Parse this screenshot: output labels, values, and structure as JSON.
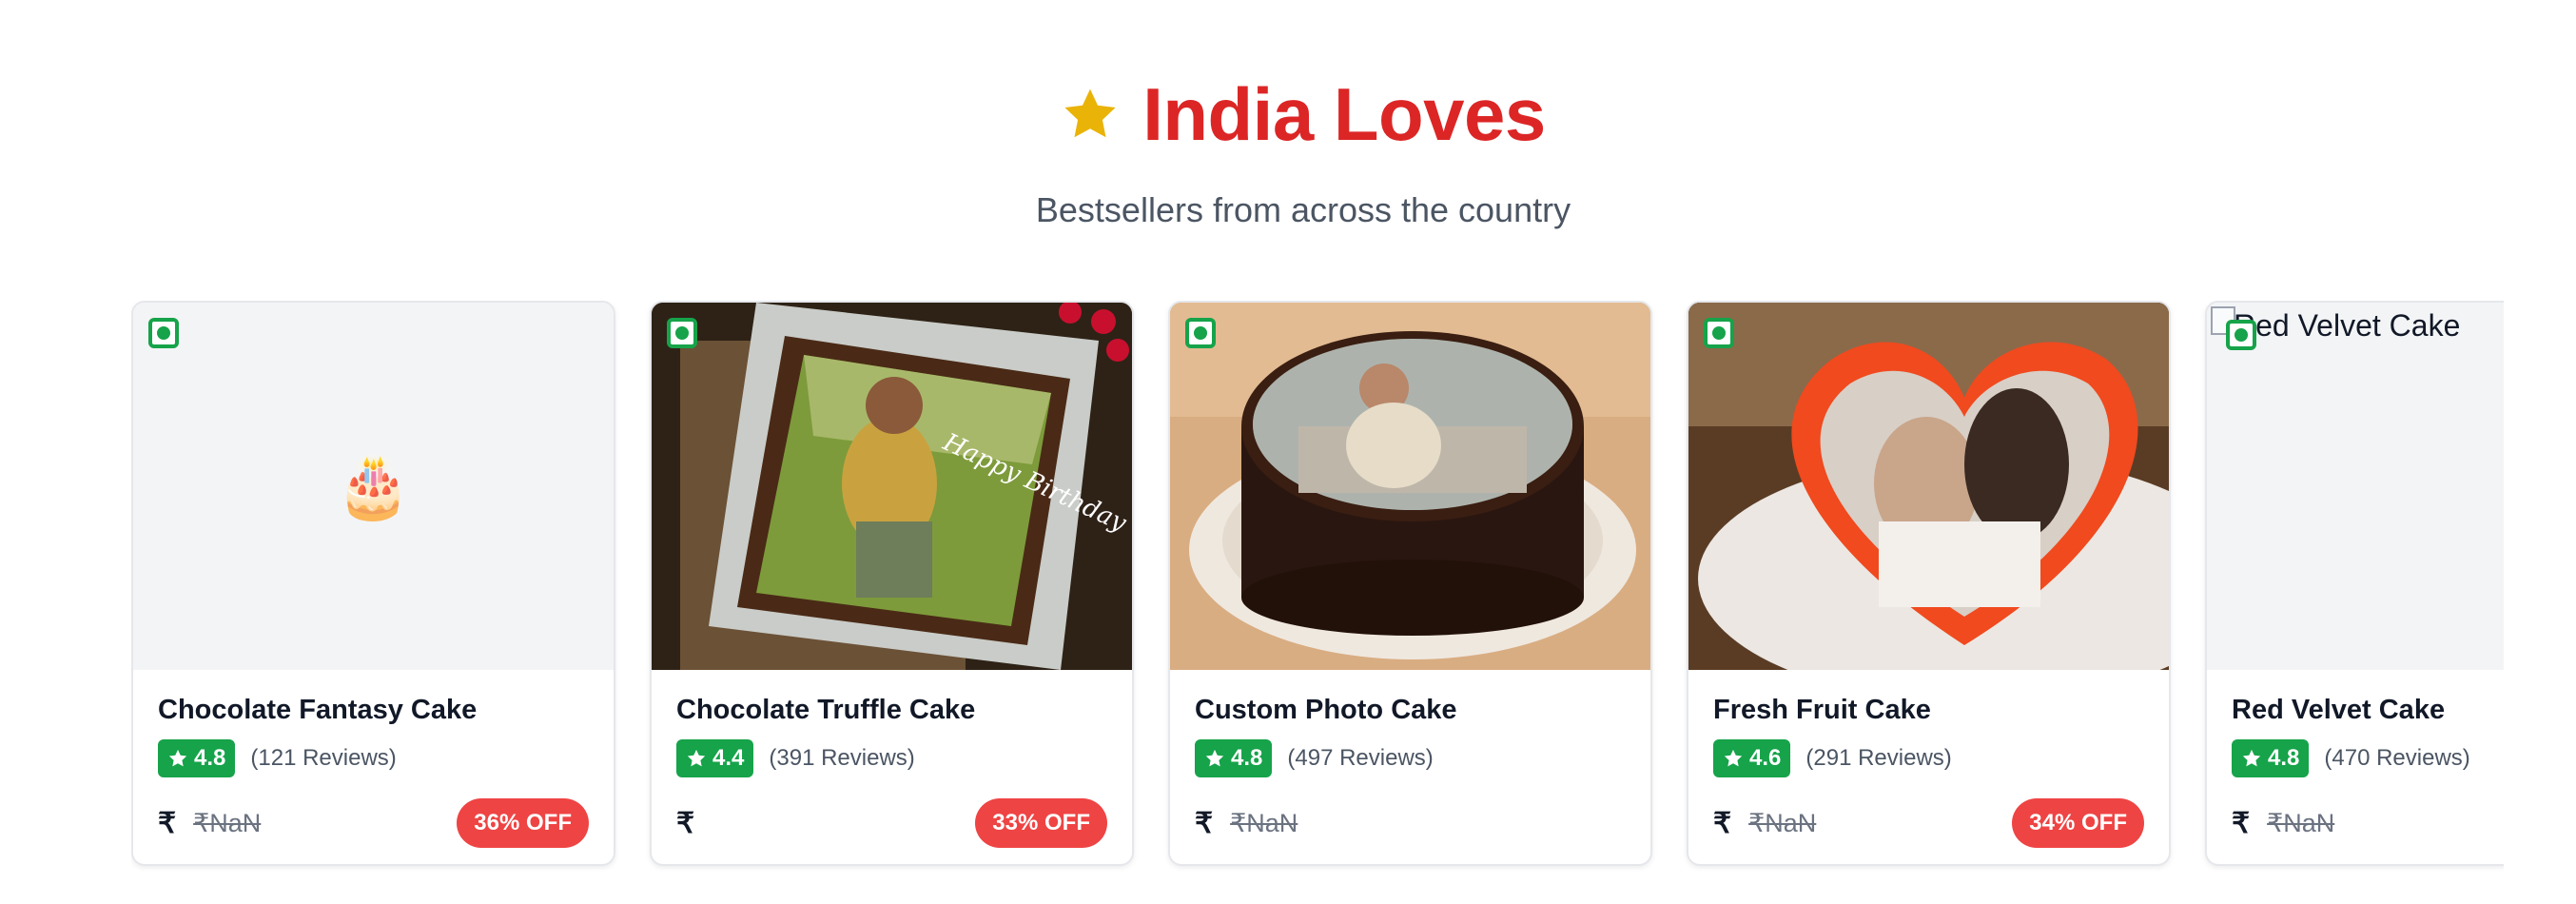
{
  "section": {
    "title": "India Loves",
    "subtitle": "Bestsellers from across the country",
    "star_color": "#eab308",
    "title_color": "#dc2626"
  },
  "products": [
    {
      "name": "Chocolate Fantasy Cake",
      "rating": "4.8",
      "reviews": "(121 Reviews)",
      "currency": "₹",
      "old_price": "₹NaN",
      "discount": "36% OFF",
      "image": "cake-emoji-placeholder",
      "image_glyph": "🎂"
    },
    {
      "name": "Chocolate Truffle Cake",
      "rating": "4.4",
      "reviews": "(391 Reviews)",
      "currency": "₹",
      "old_price": "",
      "discount": "33% OFF",
      "image": "photo-square-chocolate-cake",
      "cake_text": "Happy Birthday"
    },
    {
      "name": "Custom Photo Cake",
      "rating": "4.8",
      "reviews": "(497 Reviews)",
      "currency": "₹",
      "old_price": "₹NaN",
      "discount": "",
      "image": "photo-round-chocolate-cake"
    },
    {
      "name": "Fresh Fruit Cake",
      "rating": "4.6",
      "reviews": "(291 Reviews)",
      "currency": "₹",
      "old_price": "₹NaN",
      "discount": "34% OFF",
      "image": "photo-heart-red-cake"
    },
    {
      "name": "Red Velvet Cake",
      "rating": "4.8",
      "reviews": "(470 Reviews)",
      "currency": "₹",
      "old_price": "₹NaN",
      "discount": "",
      "image": "broken-image",
      "image_alt": "Red Velvet Cake"
    }
  ],
  "colors": {
    "veg_green": "#16a34a",
    "discount_red": "#ef4444",
    "rating_green": "#16a34a"
  }
}
